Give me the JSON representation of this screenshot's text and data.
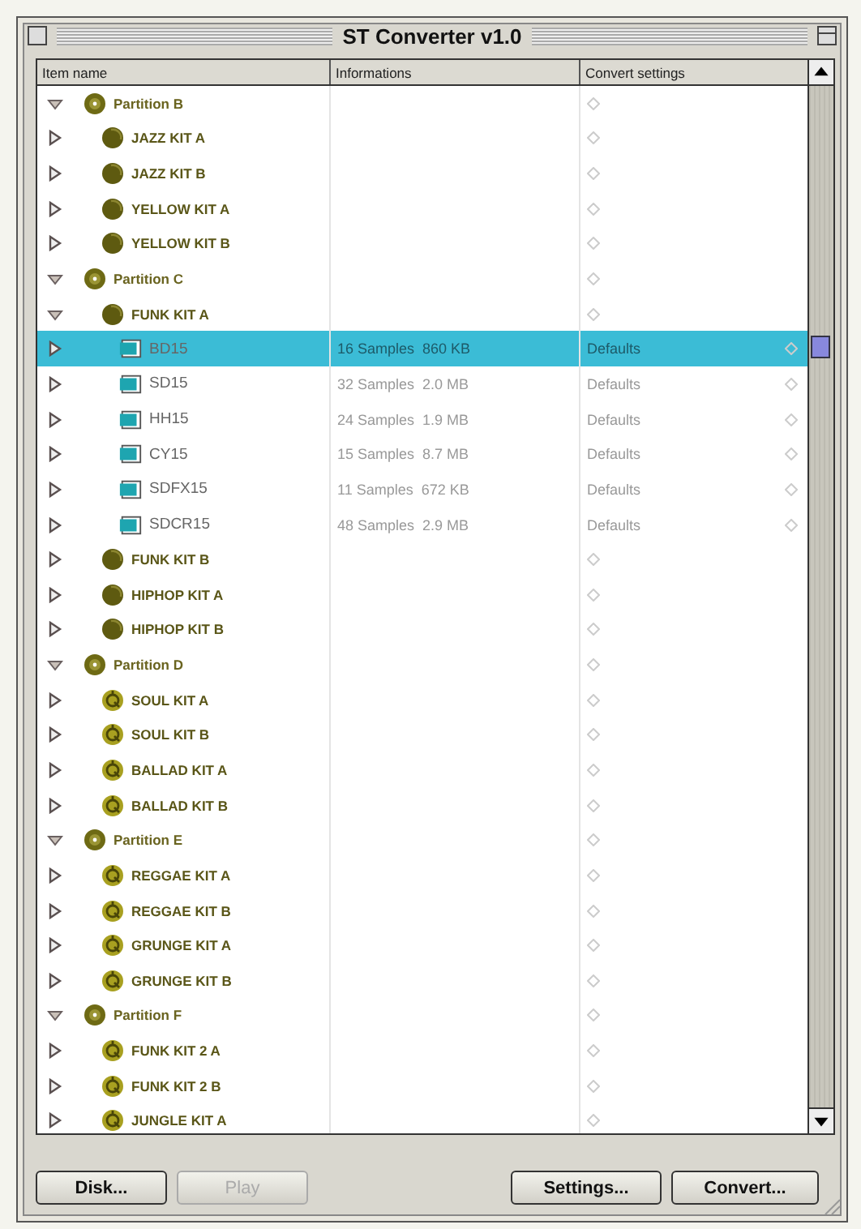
{
  "window": {
    "title": "ST Converter v1.0"
  },
  "columns": [
    "Item name",
    "Informations",
    "Convert settings"
  ],
  "tree": [
    {
      "kind": "partition",
      "name": "Partition B",
      "expanded": true,
      "selected": false,
      "children": [
        {
          "kind": "kit",
          "name": "JAZZ KIT A",
          "expanded": false,
          "selected": false
        },
        {
          "kind": "kit",
          "name": "JAZZ KIT B",
          "expanded": false,
          "selected": false
        },
        {
          "kind": "kit",
          "name": "YELLOW KIT A",
          "expanded": false,
          "selected": false
        },
        {
          "kind": "kit",
          "name": "YELLOW KIT B",
          "expanded": false,
          "selected": false
        }
      ]
    },
    {
      "kind": "partition",
      "name": "Partition C",
      "expanded": true,
      "selected": false,
      "children": [
        {
          "kind": "kit",
          "name": "FUNK KIT A",
          "expanded": true,
          "selected": false,
          "children": [
            {
              "kind": "sample",
              "name": "BD15",
              "info": "16 Samples  860 KB",
              "settings": "Defaults",
              "expanded": false,
              "selected": true
            },
            {
              "kind": "sample",
              "name": "SD15",
              "info": "32 Samples  2.0 MB",
              "settings": "Defaults",
              "expanded": false,
              "selected": false
            },
            {
              "kind": "sample",
              "name": "HH15",
              "info": "24 Samples  1.9 MB",
              "settings": "Defaults",
              "expanded": false,
              "selected": false
            },
            {
              "kind": "sample",
              "name": "CY15",
              "info": "15 Samples  8.7 MB",
              "settings": "Defaults",
              "expanded": false,
              "selected": false
            },
            {
              "kind": "sample",
              "name": "SDFX15",
              "info": "11 Samples  672 KB",
              "settings": "Defaults",
              "expanded": false,
              "selected": false
            },
            {
              "kind": "sample",
              "name": "SDCR15",
              "info": "48 Samples  2.9 MB",
              "settings": "Defaults",
              "expanded": false,
              "selected": false
            }
          ]
        },
        {
          "kind": "kit",
          "name": "FUNK KIT B",
          "expanded": false,
          "selected": false
        },
        {
          "kind": "kit",
          "name": "HIPHOP KIT A",
          "expanded": false,
          "selected": false
        },
        {
          "kind": "kit",
          "name": "HIPHOP KIT B",
          "expanded": false,
          "selected": false
        }
      ]
    },
    {
      "kind": "partition",
      "name": "Partition D",
      "expanded": true,
      "selected": false,
      "children": [
        {
          "kind": "kit_light",
          "name": "SOUL KIT A",
          "expanded": false,
          "selected": false
        },
        {
          "kind": "kit_light",
          "name": "SOUL KIT B",
          "expanded": false,
          "selected": false
        },
        {
          "kind": "kit_light",
          "name": "BALLAD KIT A",
          "expanded": false,
          "selected": false
        },
        {
          "kind": "kit_light",
          "name": "BALLAD KIT B",
          "expanded": false,
          "selected": false
        }
      ]
    },
    {
      "kind": "partition",
      "name": "Partition E",
      "expanded": true,
      "selected": false,
      "children": [
        {
          "kind": "kit_light",
          "name": "REGGAE KIT A",
          "expanded": false,
          "selected": false
        },
        {
          "kind": "kit_light",
          "name": "REGGAE KIT B",
          "expanded": false,
          "selected": false
        },
        {
          "kind": "kit_light",
          "name": "GRUNGE KIT A",
          "expanded": false,
          "selected": false
        },
        {
          "kind": "kit_light",
          "name": "GRUNGE KIT B",
          "expanded": false,
          "selected": false
        }
      ]
    },
    {
      "kind": "partition",
      "name": "Partition F",
      "expanded": true,
      "selected": false,
      "children": [
        {
          "kind": "kit_light",
          "name": "FUNK KIT 2 A",
          "expanded": false,
          "selected": false
        },
        {
          "kind": "kit_light",
          "name": "FUNK KIT 2 B",
          "expanded": false,
          "selected": false
        },
        {
          "kind": "kit_light",
          "name": "JUNGLE KIT A",
          "expanded": false,
          "selected": false
        }
      ]
    }
  ],
  "buttons": [
    {
      "label": "Disk...",
      "disabled": false
    },
    {
      "label": "Play",
      "disabled": true
    },
    {
      "label": "Settings...",
      "disabled": false
    },
    {
      "label": "Convert...",
      "disabled": false
    }
  ]
}
